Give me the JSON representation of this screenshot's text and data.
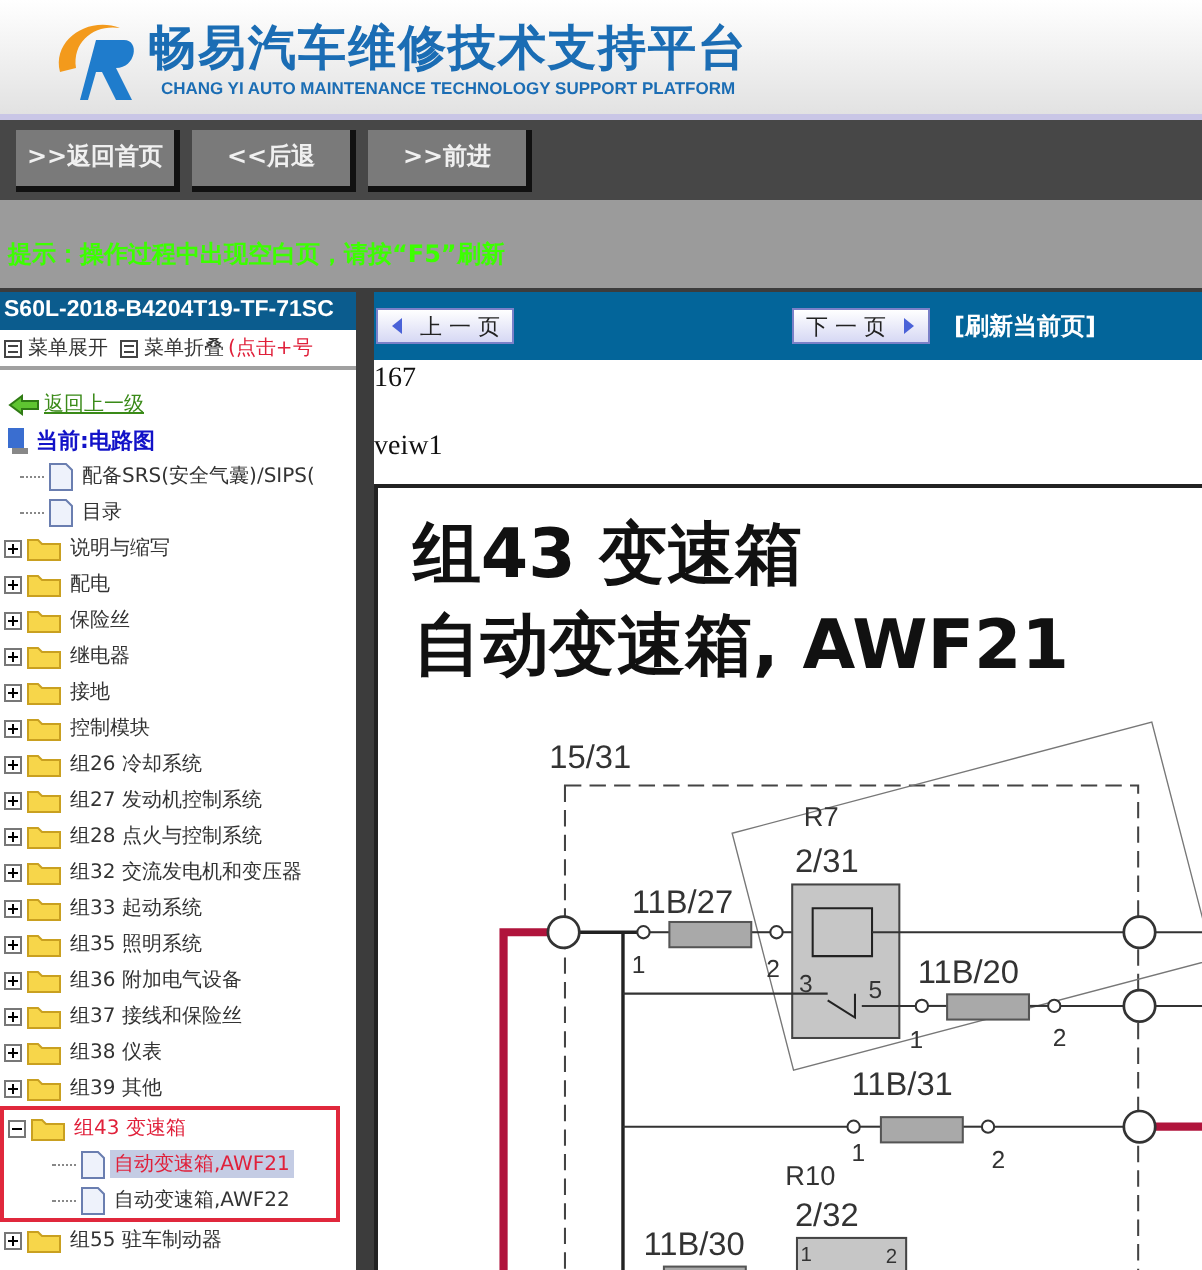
{
  "header": {
    "title": "畅易汽车维修技术支持平台",
    "subtitle": "CHANG YI AUTO MAINTENANCE TECHNOLOGY SUPPORT PLATFORM"
  },
  "nav_buttons": [
    ">>返回首页",
    "<<后退",
    ">>前进"
  ],
  "hint": "提示：操作过程中出现空白页，请按“F5”刷新",
  "sidebar": {
    "title": "S60L-2018-B4204T19-TF-71SC",
    "menu": [
      "菜单展开",
      "菜单折叠"
    ],
    "menu_note": "(点击+号",
    "back_link": "返回上一级",
    "current": "当前:电路图",
    "tree": [
      {
        "kind": "page",
        "label": "配备SRS(安全气囊)/SIPS(",
        "selected": false
      },
      {
        "kind": "page",
        "label": "目录",
        "selected": false
      },
      {
        "kind": "folder",
        "label": "说明与缩写",
        "expanded": false
      },
      {
        "kind": "folder",
        "label": "配电",
        "expanded": false
      },
      {
        "kind": "folder",
        "label": "保险丝",
        "expanded": false
      },
      {
        "kind": "folder",
        "label": "继电器",
        "expanded": false
      },
      {
        "kind": "folder",
        "label": "接地",
        "expanded": false
      },
      {
        "kind": "folder",
        "label": "控制模块",
        "expanded": false
      },
      {
        "kind": "folder",
        "label": "组26 冷却系统",
        "expanded": false
      },
      {
        "kind": "folder",
        "label": "组27 发动机控制系统",
        "expanded": false
      },
      {
        "kind": "folder",
        "label": "组28 点火与控制系统",
        "expanded": false
      },
      {
        "kind": "folder",
        "label": "组32 交流发电机和变压器",
        "expanded": false
      },
      {
        "kind": "folder",
        "label": "组33 起动系统",
        "expanded": false
      },
      {
        "kind": "folder",
        "label": "组35 照明系统",
        "expanded": false
      },
      {
        "kind": "folder",
        "label": "组36 附加电气设备",
        "expanded": false
      },
      {
        "kind": "folder",
        "label": "组37 接线和保险丝",
        "expanded": false
      },
      {
        "kind": "folder",
        "label": "组38 仪表",
        "expanded": false
      },
      {
        "kind": "folder",
        "label": "组39 其他",
        "expanded": false
      },
      {
        "kind": "folder",
        "label": "组43 变速箱",
        "expanded": true,
        "annotated": true,
        "children": [
          {
            "kind": "page",
            "label": "自动变速箱,AWF21",
            "selected": true
          },
          {
            "kind": "page",
            "label": "自动变速箱,AWF22",
            "selected": false
          }
        ]
      },
      {
        "kind": "folder",
        "label": "组55 驻车制动器",
        "expanded": false
      }
    ]
  },
  "content": {
    "prev": "上 一 页",
    "next": "下 一 页",
    "refresh": "[刷新当前页]",
    "lines": [
      "167",
      "veiw1"
    ],
    "diagram": {
      "title_lines": [
        "组43 变速箱",
        "自动变速箱, AWF21"
      ],
      "labels": [
        "15/31",
        "R7",
        "2/31",
        "11B/27",
        "1",
        "2",
        "3",
        "5",
        "11B/20",
        "1",
        "2",
        "11B/31",
        "1",
        "2",
        "R10",
        "2/32",
        "11B/30",
        "1",
        "2"
      ]
    }
  }
}
